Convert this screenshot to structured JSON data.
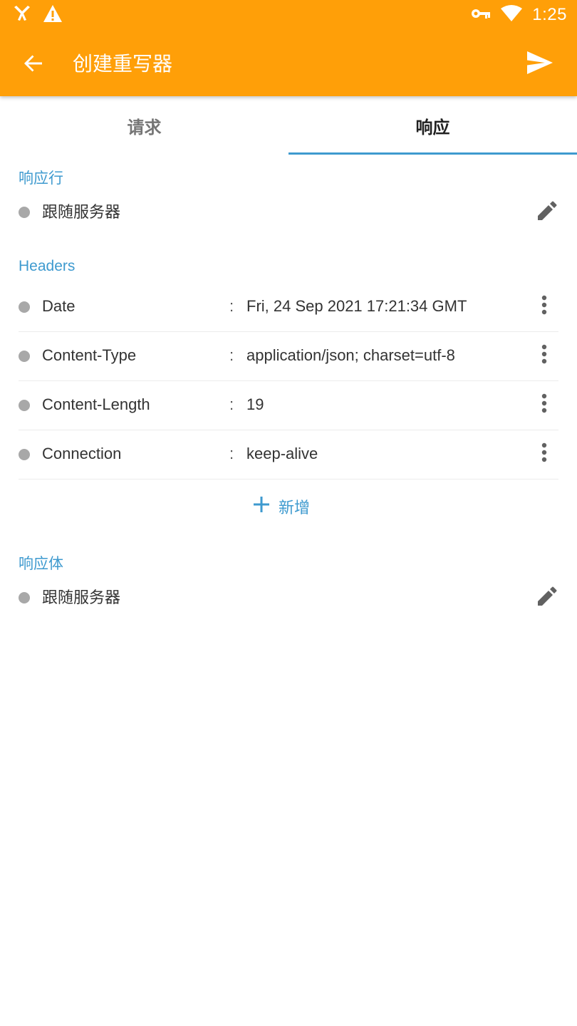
{
  "status_bar": {
    "time": "1:25",
    "icons": [
      "app-notification-icon",
      "warning-icon",
      "vpn-key-icon",
      "wifi-icon"
    ]
  },
  "toolbar": {
    "title": "创建重写器",
    "back_icon": "arrow-back-icon",
    "send_icon": "send-icon"
  },
  "tabs": [
    {
      "label": "请求",
      "active": false
    },
    {
      "label": "响应",
      "active": true
    }
  ],
  "response_line": {
    "section_title": "响应行",
    "value": "跟随服务器",
    "edit_icon": "pencil-icon"
  },
  "headers": {
    "section_title": "Headers",
    "colon": ":",
    "rows": [
      {
        "name": "Date",
        "value": "Fri, 24 Sep 2021 17:21:34 GMT"
      },
      {
        "name": "Content-Type",
        "value": "application/json; charset=utf-8"
      },
      {
        "name": "Content-Length",
        "value": "19"
      },
      {
        "name": "Connection",
        "value": "keep-alive"
      }
    ],
    "add_label": "新增"
  },
  "response_body": {
    "section_title": "响应体",
    "value": "跟随服务器",
    "edit_icon": "pencil-icon"
  },
  "colors": {
    "appbar": "#FF9F08",
    "accent": "#3E9ACF",
    "dot": "#A8A8A8"
  }
}
